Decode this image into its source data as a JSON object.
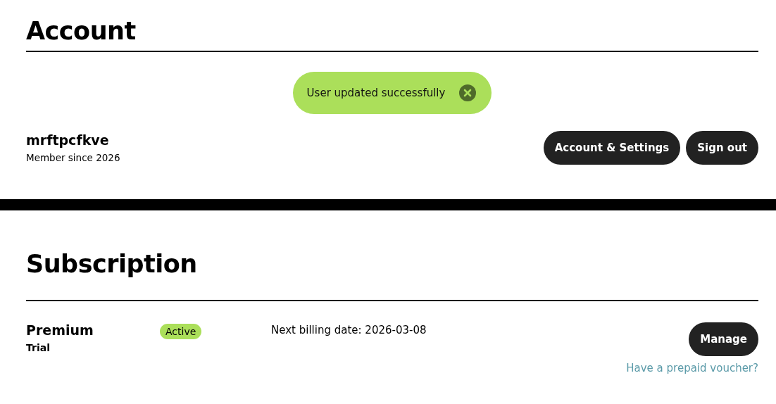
{
  "account": {
    "title": "Account",
    "toast": {
      "message": "User updated successfully"
    },
    "user": {
      "name": "mrftpcfkve",
      "member_since": "Member since 2026"
    },
    "buttons": [
      "Account & Settings",
      "Sign out"
    ]
  },
  "subscription": {
    "title": "Subscription",
    "plan": {
      "name": "Premium",
      "type": "Trial",
      "status": "Active",
      "next_billing": "Next billing date: 2026-03-08"
    },
    "manage_button": "Manage",
    "voucher_link": "Have a prepaid voucher?"
  }
}
